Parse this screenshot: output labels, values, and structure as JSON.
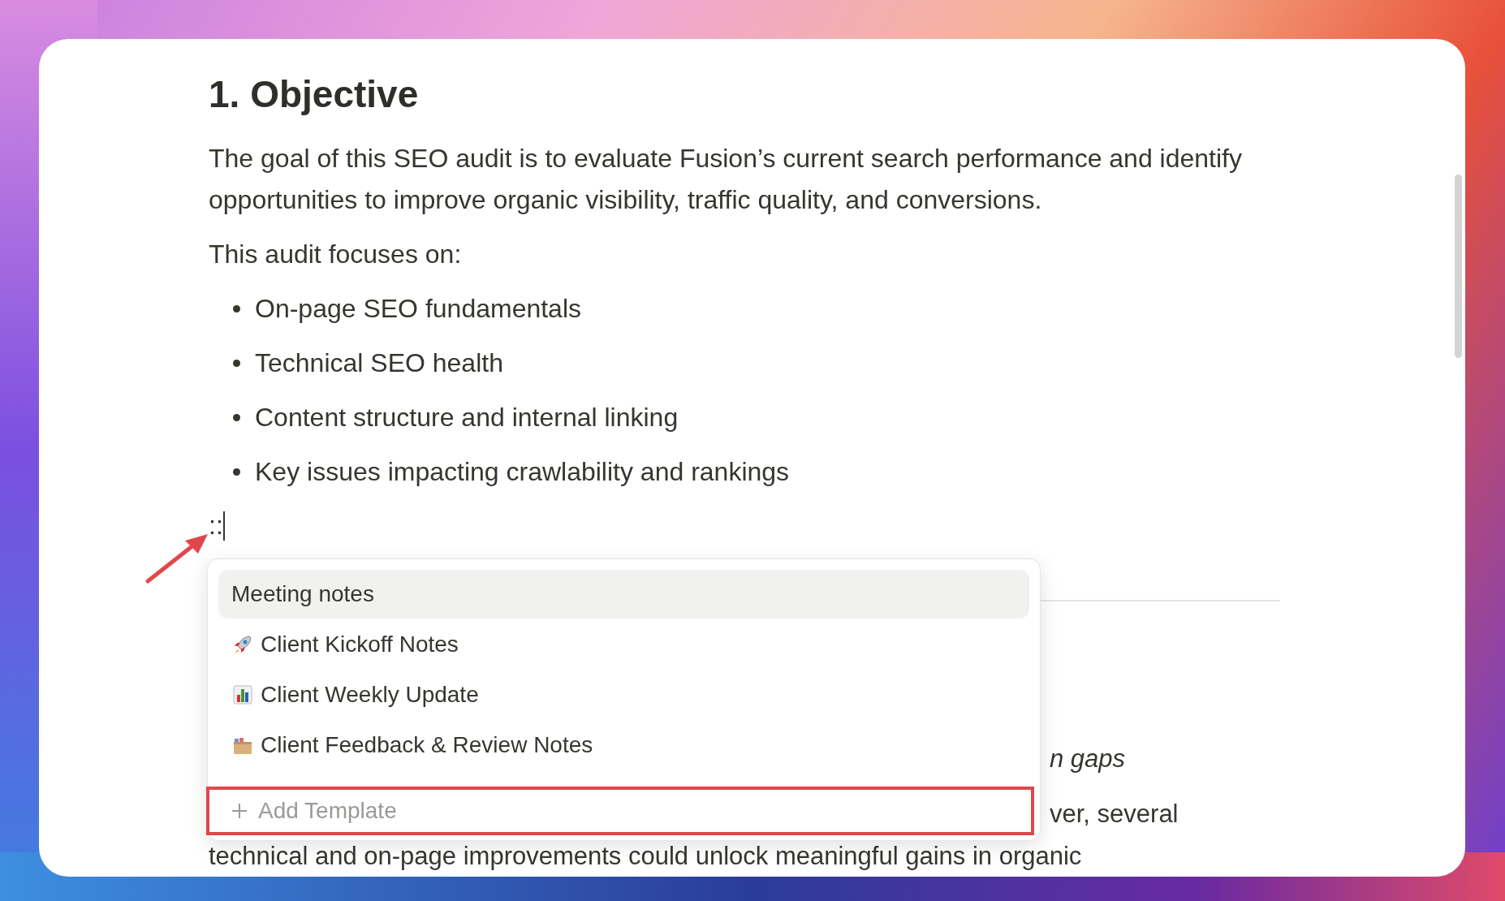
{
  "document": {
    "heading": "1. Objective",
    "intro": "The goal of this SEO audit is to evaluate Fusion’s current search performance and identify opportunities to improve organic visibility, traffic quality, and conversions.",
    "focus_label": "This audit focuses on:",
    "bullets": [
      "On-page SEO fundamentals",
      "Technical SEO health",
      "Content structure and internal linking",
      "Key issues impacting crawlability and rankings"
    ],
    "typed": "::",
    "hidden_fragments": [
      "n gaps",
      "ver, several"
    ],
    "last_line": "technical and on-page improvements could unlock meaningful gains in organic"
  },
  "template_menu": {
    "items": [
      {
        "kind": "heading",
        "label": "Meeting notes",
        "selected": true
      },
      {
        "kind": "rocket",
        "label": "Client Kickoff Notes",
        "selected": false
      },
      {
        "kind": "chart",
        "label": "Client Weekly Update",
        "selected": false
      },
      {
        "kind": "box",
        "label": "Client Feedback & Review Notes",
        "selected": false
      }
    ],
    "add_button": "Add Template"
  }
}
